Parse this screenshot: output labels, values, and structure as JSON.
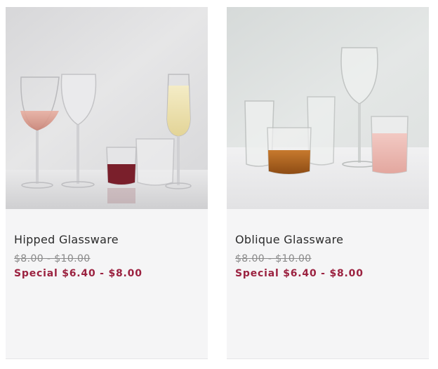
{
  "products": [
    {
      "name": "Hipped Glassware",
      "regular_price": "$8.00 - $10.00",
      "special_price": "Special $6.40 - $8.00",
      "image_icon": "wine-glasses-photo"
    },
    {
      "name": "Oblique Glassware",
      "regular_price": "$8.00 - $10.00",
      "special_price": "Special $6.40 - $8.00",
      "image_icon": "glassware-set-photo"
    }
  ],
  "colors": {
    "card_background": "#f5f5f6",
    "title": "#2b2b2b",
    "strikethrough_price": "#8a8a8a",
    "special_price": "#9b2240"
  }
}
